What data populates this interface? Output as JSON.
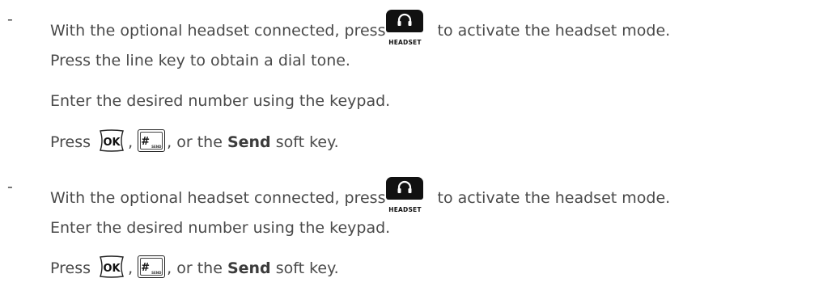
{
  "bullet": "-",
  "step1": {
    "line1_before": "With the optional headset connected, press",
    "line1_after": "to activate the headset mode.",
    "line2": "Press the line key to obtain a dial tone.",
    "line3": "Enter the desired number using the keypad.",
    "line4_press": "Press",
    "line4_sep": ",",
    "line4_after": ", or the",
    "line4_bold": "Send",
    "line4_end": "soft key."
  },
  "step2": {
    "line1_before": "With the optional headset connected, press",
    "line1_after": "to activate the headset mode.",
    "line2": "Enter the desired number using the keypad.",
    "line3_press": "Press",
    "line3_sep": ",",
    "line3_after": ", or the",
    "line3_bold": "Send",
    "line3_end": "soft key."
  },
  "keys": {
    "headset_label": "HEADSET",
    "ok_label": "OK",
    "hash_label": "#",
    "hash_sub": "SEND"
  },
  "icons": [
    "headset-key-icon",
    "ok-key-icon",
    "hash-send-key-icon"
  ]
}
